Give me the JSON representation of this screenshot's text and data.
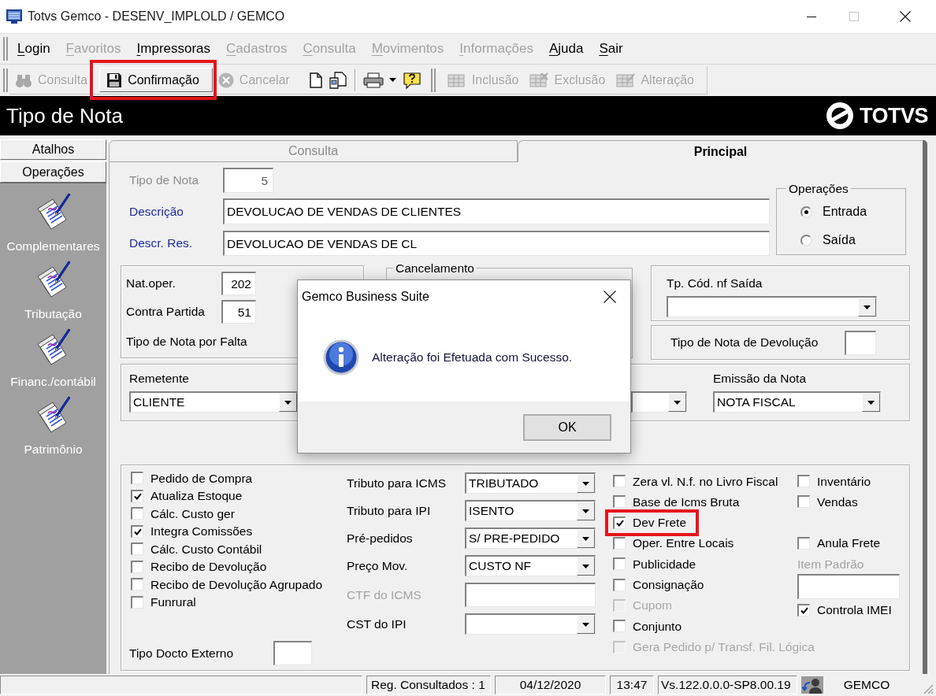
{
  "window": {
    "title": "Totvs Gemco - DESENV_IMPLOLD / GEMCO"
  },
  "menu": [
    {
      "label": "Login",
      "disabled": false
    },
    {
      "label": "Favoritos",
      "disabled": true
    },
    {
      "label": "Impressoras",
      "disabled": false
    },
    {
      "label": "Cadastros",
      "disabled": true
    },
    {
      "label": "Consulta",
      "disabled": true
    },
    {
      "label": "Movimentos",
      "disabled": true
    },
    {
      "label": "Informações",
      "disabled": true
    },
    {
      "label": "Ajuda",
      "disabled": false
    },
    {
      "label": "Sair",
      "disabled": false
    }
  ],
  "toolbar": [
    {
      "kind": "button",
      "label": "Consulta",
      "disabled": true,
      "hovered": false,
      "highlighted": false
    },
    {
      "kind": "button",
      "label": "Confirmação",
      "disabled": false,
      "hovered": true,
      "highlighted": true
    },
    {
      "kind": "button",
      "label": "Cancelar",
      "disabled": true,
      "hovered": false,
      "highlighted": false
    },
    {
      "kind": "icon",
      "disabled": false,
      "hovered": false,
      "highlighted": false
    },
    {
      "kind": "icon",
      "disabled": false,
      "hovered": false,
      "highlighted": false
    },
    {
      "kind": "icon",
      "disabled": false,
      "hovered": false,
      "highlighted": false
    },
    {
      "kind": "icon",
      "disabled": false,
      "hovered": false,
      "highlighted": false
    },
    {
      "kind": "button",
      "label": "Inclusão",
      "disabled": true,
      "hovered": false,
      "highlighted": false
    },
    {
      "kind": "button",
      "label": "Exclusão",
      "disabled": true,
      "hovered": false,
      "highlighted": false
    },
    {
      "kind": "button",
      "label": "Alteração",
      "disabled": true,
      "hovered": false,
      "highlighted": false
    }
  ],
  "header": {
    "title": "Tipo de Nota",
    "logo": "TOTVS"
  },
  "sidebar": {
    "sections": [
      "Atalhos",
      "Operações"
    ],
    "items": [
      "Complementares",
      "Tributação",
      "Financ./contábil",
      "Patrimônio"
    ]
  },
  "tabs": [
    {
      "label": "Consulta",
      "selected": false
    },
    {
      "label": "Principal",
      "selected": true
    }
  ],
  "form": {
    "header_fields": [
      {
        "label": "Tipo de Nota",
        "value": "5",
        "disabled": true,
        "required": false
      },
      {
        "label": "Descrição",
        "value": "DEVOLUCAO DE VENDAS DE CLIENTES",
        "disabled": false,
        "required": true
      },
      {
        "label": "Descr. Res.",
        "value": "DEVOLUCAO DE VENDAS DE CL",
        "disabled": false,
        "required": true
      }
    ],
    "operacoes": {
      "title": "Operações",
      "options": [
        {
          "label": "Entrada",
          "selected": true
        },
        {
          "label": "Saída",
          "selected": false
        }
      ]
    },
    "naturezas": [
      {
        "kind": "field",
        "label": "Nat.oper.",
        "value": "202"
      },
      {
        "kind": "field",
        "label": "Contra Partida",
        "value": "51"
      },
      {
        "kind": "text",
        "label": "Tipo de Nota por Falta"
      }
    ],
    "cancelamento": {
      "title": "Cancelamento"
    },
    "tp_cod_nf_saida": {
      "label": "Tp. Cód. nf Saída"
    },
    "tipo_nota_devolucao": {
      "label": "Tipo de Nota de Devolução"
    },
    "remetente": {
      "label": "Remetente",
      "value": "CLIENTE"
    },
    "emissao_da_nota": {
      "label": "Emissão da Nota",
      "value": "NOTA FISCAL"
    },
    "options_left": [
      {
        "label": "Pedido de Compra",
        "checked": false
      },
      {
        "label": "Atualiza Estoque",
        "checked": true
      },
      {
        "label": "Cálc. Custo ger",
        "checked": false
      },
      {
        "label": "Integra Comissões",
        "checked": true
      },
      {
        "label": "Cálc. Custo Contábil",
        "checked": false
      },
      {
        "label": "Recibo de Devolução",
        "checked": false
      },
      {
        "label": "Recibo de Devolução Agrupado",
        "checked": false
      },
      {
        "label": "Funrural",
        "checked": false
      }
    ],
    "tipo_docto_externo": {
      "label": "Tipo Docto Externo"
    },
    "tributos": [
      {
        "kind": "combo",
        "label": "Tributo para ICMS",
        "value": "TRIBUTADO",
        "disabled": false
      },
      {
        "kind": "combo",
        "label": "Tributo para IPI",
        "value": "ISENTO",
        "disabled": false
      },
      {
        "kind": "combo",
        "label": "Pré-pedidos",
        "value": "S/ PRE-PEDIDO",
        "disabled": false
      },
      {
        "kind": "combo",
        "label": "Preço Mov.",
        "value": "CUSTO NF",
        "disabled": false
      },
      {
        "kind": "text",
        "label": "CTF do ICMS",
        "disabled": true
      },
      {
        "kind": "combo",
        "label": "CST do IPI",
        "disabled": false
      }
    ],
    "options_right": [
      {
        "label": "Zera vl. N.f. no Livro Fiscal",
        "checked": false,
        "disabled": false,
        "highlighted": false
      },
      {
        "label": "Base de Icms Bruta",
        "checked": false,
        "disabled": false,
        "highlighted": false
      },
      {
        "label": "Dev Frete",
        "checked": true,
        "disabled": false,
        "highlighted": true
      },
      {
        "label": "Oper. Entre Locais",
        "checked": false,
        "disabled": false,
        "highlighted": false
      },
      {
        "label": "Publicidade",
        "checked": false,
        "disabled": false,
        "highlighted": false
      },
      {
        "label": "Consignação",
        "checked": false,
        "disabled": false,
        "highlighted": false
      },
      {
        "label": "Cupom",
        "checked": false,
        "disabled": true,
        "highlighted": false
      },
      {
        "label": "Conjunto",
        "checked": false,
        "disabled": false,
        "highlighted": false
      },
      {
        "label": "Gera Pedido p/ Transf. Fil. Lógica",
        "checked": false,
        "disabled": true,
        "highlighted": false
      }
    ],
    "options_extra": [
      {
        "kind": "checkbox",
        "label": "Inventário",
        "checked": false
      },
      {
        "kind": "checkbox",
        "label": "Vendas",
        "checked": false
      },
      {
        "kind": "checkbox",
        "label": "Anula Frete",
        "checked": false
      },
      {
        "kind": "field",
        "label": "Item Padrão",
        "disabled": true
      },
      {
        "kind": "checkbox",
        "label": "Controla IMEI",
        "checked": true
      }
    ]
  },
  "status_bar": {
    "records": "Reg. Consultados : 1",
    "date": "04/12/2020",
    "time": "13:47",
    "version": "Vs.122.0.0.0-SP8.00.19",
    "user": "GEMCO"
  },
  "dialog": {
    "title": "Gemco Business Suite",
    "message": "Alteração foi Efetuada com Sucesso.",
    "buttons": [
      "OK"
    ]
  }
}
